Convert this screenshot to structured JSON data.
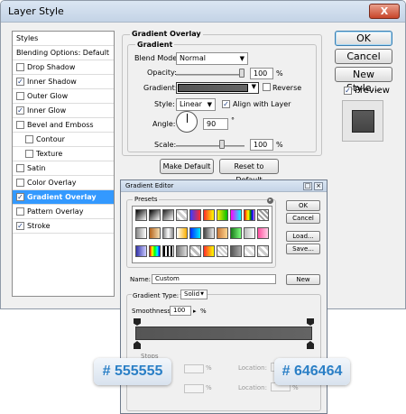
{
  "window": {
    "title": "Layer Style",
    "close_label": "X"
  },
  "styles_panel": {
    "header": "Styles",
    "blending": "Blending Options: Default",
    "items": [
      {
        "label": "Drop Shadow",
        "checked": false
      },
      {
        "label": "Inner Shadow",
        "checked": true
      },
      {
        "label": "Outer Glow",
        "checked": false
      },
      {
        "label": "Inner Glow",
        "checked": true
      },
      {
        "label": "Bevel and Emboss",
        "checked": false
      },
      {
        "label": "Contour",
        "checked": false
      },
      {
        "label": "Texture",
        "checked": false
      },
      {
        "label": "Satin",
        "checked": false
      },
      {
        "label": "Color Overlay",
        "checked": false
      },
      {
        "label": "Gradient Overlay",
        "checked": true,
        "selected": true
      },
      {
        "label": "Pattern Overlay",
        "checked": false
      },
      {
        "label": "Stroke",
        "checked": true
      }
    ]
  },
  "gradient_overlay": {
    "group_title": "Gradient Overlay",
    "sub_title": "Gradient",
    "blend_mode_label": "Blend Mode:",
    "blend_mode_value": "Normal",
    "opacity_label": "Opacity:",
    "opacity_value": "100",
    "opacity_unit": "%",
    "opacity_level": 1.0,
    "gradient_label": "Gradient:",
    "reverse_label": "Reverse",
    "reverse_checked": false,
    "style_label": "Style:",
    "style_value": "Linear",
    "align_label": "Align with Layer",
    "align_checked": true,
    "angle_label": "Angle:",
    "angle_value": "90",
    "angle_unit": "°",
    "scale_label": "Scale:",
    "scale_value": "100",
    "scale_unit": "%",
    "make_default": "Make Default",
    "reset_default": "Reset to Default"
  },
  "right_buttons": {
    "ok": "OK",
    "cancel": "Cancel",
    "new_style": "New Style...",
    "preview_label": "Preview",
    "preview_checked": true
  },
  "gradient_editor": {
    "title": "Gradient Editor",
    "presets_label": "Presets",
    "ok": "OK",
    "cancel": "Cancel",
    "load": "Load...",
    "save": "Save...",
    "name_label": "Name:",
    "name_value": "Custom",
    "new_button": "New",
    "gradient_type_label": "Gradient Type:",
    "gradient_type_value": "Solid",
    "smoothness_label": "Smoothness:",
    "smoothness_value": "100",
    "smoothness_unit": "%",
    "stops_label": "Stops",
    "opacity_unit": "%",
    "location_label": "Location:",
    "location_unit": "%"
  },
  "annotations": {
    "left_color": "# 555555",
    "right_color": "# 646464"
  },
  "colors": {
    "gradient_start": "#555555",
    "gradient_end": "#646464",
    "selection": "#3399ff",
    "annotation_text": "#2a7fc6"
  }
}
